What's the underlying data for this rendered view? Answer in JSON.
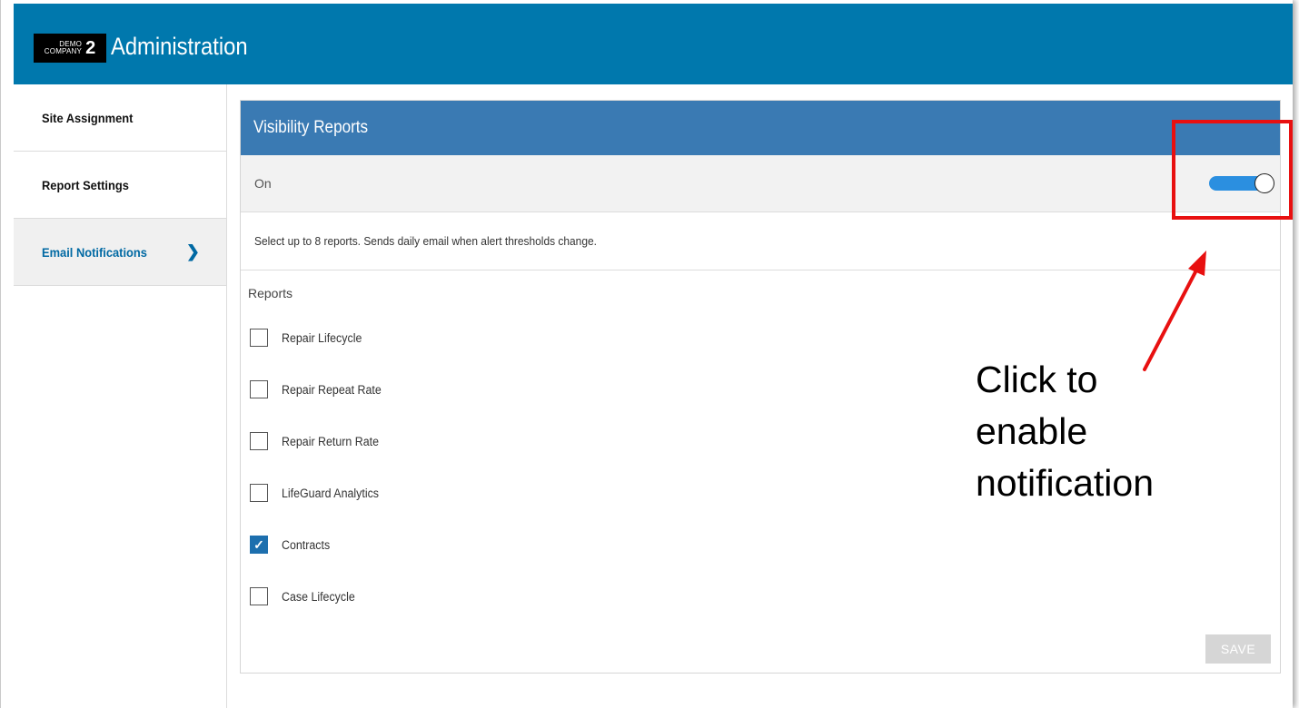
{
  "header": {
    "logo_top": "DEMO",
    "logo_bottom": "COMPANY",
    "logo_number": "2",
    "title": "Administration"
  },
  "sidebar": {
    "items": [
      {
        "label": "Site Assignment",
        "active": false
      },
      {
        "label": "Report Settings",
        "active": false
      },
      {
        "label": "Email Notifications",
        "active": true,
        "icon": "chevron-right-icon"
      }
    ]
  },
  "panel": {
    "title": "Visibility Reports",
    "toggle_label": "On",
    "toggle_on": true,
    "description": "Select up to 8 reports. Sends daily email when alert thresholds change.",
    "reports_label": "Reports",
    "reports": [
      {
        "label": "Repair Lifecycle",
        "checked": false
      },
      {
        "label": "Repair Repeat Rate",
        "checked": false
      },
      {
        "label": "Repair Return Rate",
        "checked": false
      },
      {
        "label": "LifeGuard Analytics",
        "checked": false
      },
      {
        "label": "Contracts",
        "checked": true
      },
      {
        "label": "Case Lifecycle",
        "checked": false
      }
    ],
    "save_label": "SAVE"
  },
  "annotation": {
    "text": "Click to\nenable\nnotification"
  },
  "colors": {
    "header_bg": "#0078ad",
    "panel_header_bg": "#3a7ab3",
    "toggle_on": "#2b8fe0",
    "checkbox_checked": "#1d6fae",
    "highlight": "#e81010",
    "active_link": "#0069a3"
  }
}
